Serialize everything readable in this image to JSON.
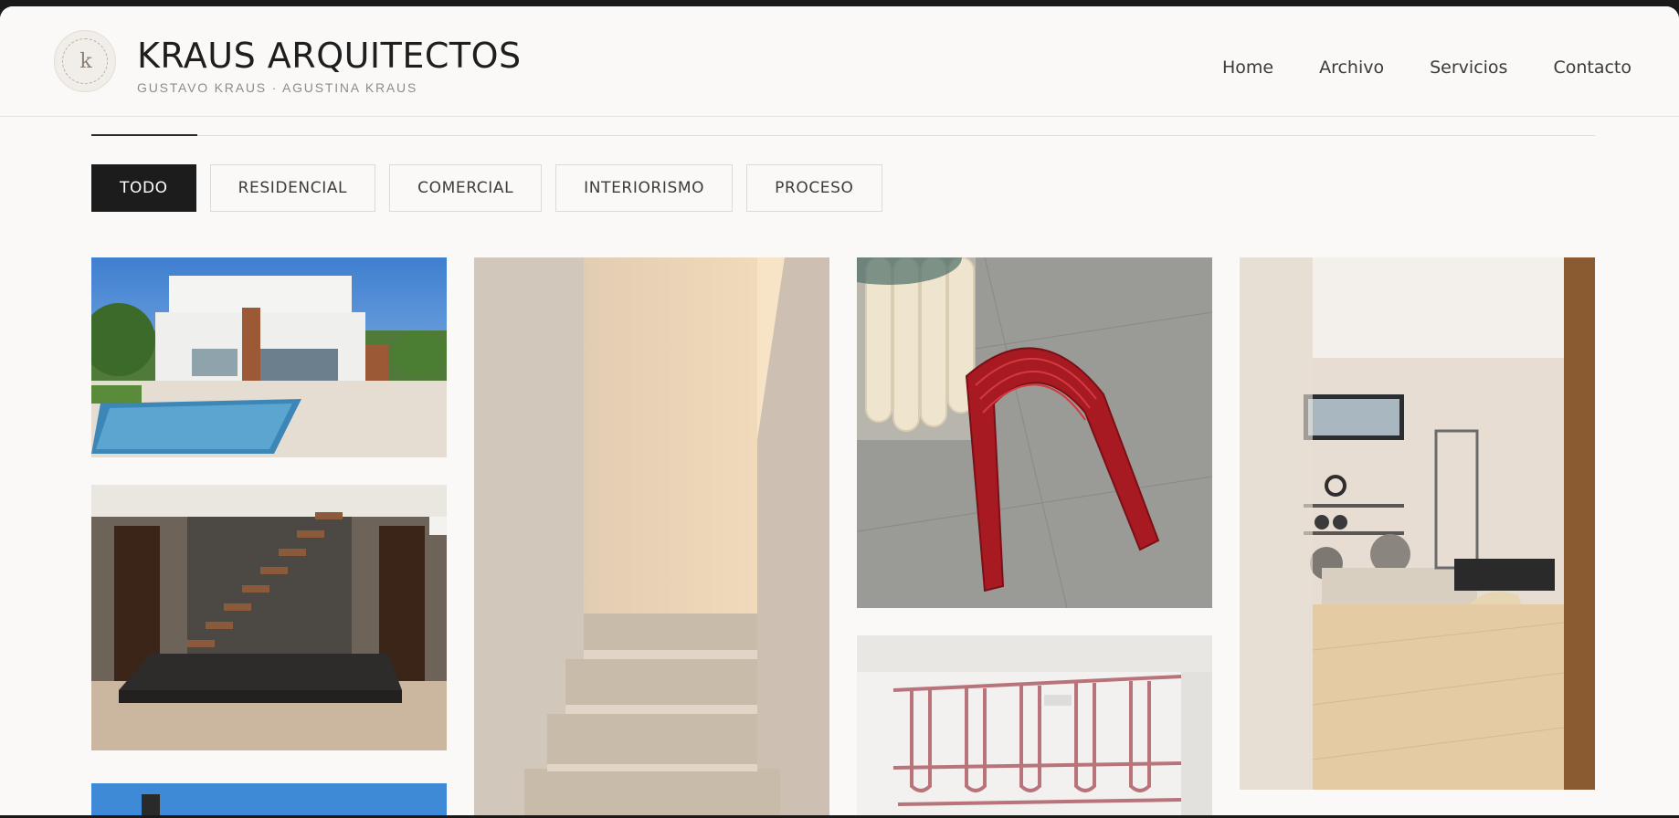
{
  "header": {
    "logo_letter": "k",
    "title": "KRAUS ARQUITECTOS",
    "subtitle": "GUSTAVO KRAUS · AGUSTINA KRAUS"
  },
  "nav": {
    "items": [
      "Home",
      "Archivo",
      "Servicios",
      "Contacto"
    ]
  },
  "filters": {
    "items": [
      "TODO",
      "RESIDENCIAL",
      "COMERCIAL",
      "INTERIORISMO",
      "PROCESO"
    ],
    "active": "TODO"
  },
  "gallery": {
    "images": [
      {
        "id": "house-pool",
        "subject": "white modern house with pool"
      },
      {
        "id": "stair-dark",
        "subject": "floating wooden staircase on dark platform"
      },
      {
        "id": "exterior-blue",
        "subject": "building against blue sky"
      },
      {
        "id": "stair-beige",
        "subject": "beige plaster staircase with hidden light"
      },
      {
        "id": "red-stool",
        "subject": "red ribbed stool on grey tiles"
      },
      {
        "id": "pink-rack",
        "subject": "pink tubular metal shelving"
      },
      {
        "id": "pilates-room",
        "subject": "pilates studio with wood floor"
      }
    ]
  },
  "colors": {
    "background": "#faf9f7",
    "active_tab": "#1c1c1c",
    "text": "#1e1e1e"
  }
}
